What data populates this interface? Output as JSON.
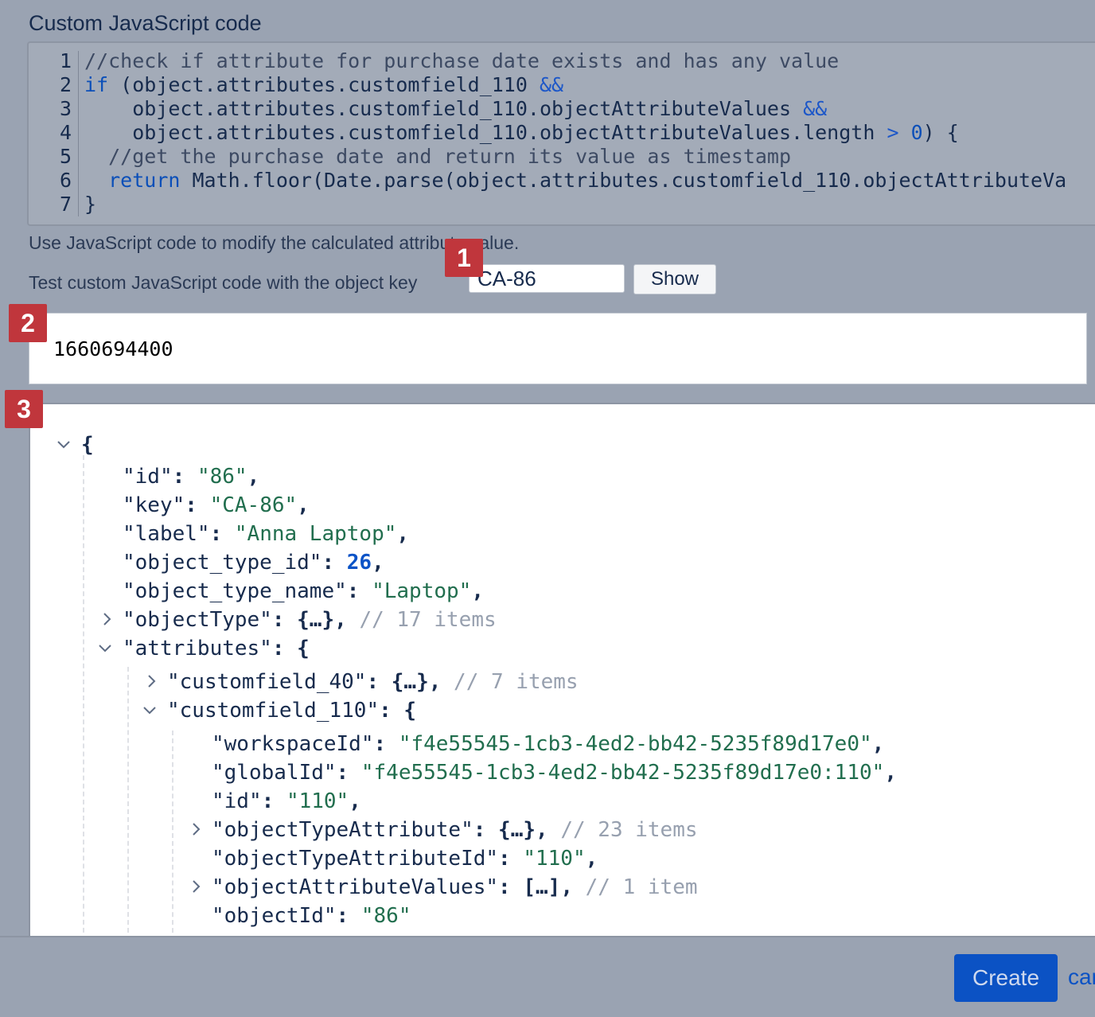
{
  "section_title": "Custom JavaScript code",
  "code_lines": [
    {
      "num": "1",
      "parts": [
        {
          "t": "//check if attribute for purchase date exists and has any value",
          "c": "comment"
        }
      ]
    },
    {
      "num": "2",
      "parts": [
        {
          "t": "if",
          "c": "kw"
        },
        {
          "t": " (object.attributes.customfield_110 ",
          "c": ""
        },
        {
          "t": "&&",
          "c": "op"
        }
      ]
    },
    {
      "num": "3",
      "parts": [
        {
          "t": "    object.attributes.customfield_110.objectAttributeValues ",
          "c": ""
        },
        {
          "t": "&&",
          "c": "op"
        }
      ]
    },
    {
      "num": "4",
      "parts": [
        {
          "t": "    object.attributes.customfield_110.objectAttributeValues.length ",
          "c": ""
        },
        {
          "t": ">",
          "c": "op"
        },
        {
          "t": " ",
          "c": ""
        },
        {
          "t": "0",
          "c": "num"
        },
        {
          "t": ") {",
          "c": ""
        }
      ]
    },
    {
      "num": "5",
      "parts": [
        {
          "t": "  //get the purchase date and return its value as timestamp",
          "c": "comment"
        }
      ]
    },
    {
      "num": "6",
      "parts": [
        {
          "t": "  ",
          "c": ""
        },
        {
          "t": "return",
          "c": "kw"
        },
        {
          "t": " Math.floor(Date.parse(object.attributes.customfield_110.objectAttributeVa",
          "c": ""
        }
      ]
    },
    {
      "num": "7",
      "parts": [
        {
          "t": "}",
          "c": ""
        }
      ]
    }
  ],
  "help_text": "Use JavaScript code to modify the calculated attribute value.",
  "test_label": "Test custom JavaScript code with the object key",
  "object_key_value": "CA-86",
  "show_label": "Show",
  "result_value": "1660694400",
  "badges": [
    "1",
    "2",
    "3"
  ],
  "json_lines": [
    {
      "toggle": "open",
      "parts": [
        {
          "t": "{",
          "c": "punc"
        }
      ]
    },
    {
      "parts": [
        {
          "t": "\"id\"",
          "c": ""
        },
        {
          "t": ": ",
          "c": "punc"
        },
        {
          "t": "\"86\"",
          "c": "str"
        },
        {
          "t": ",",
          "c": "punc"
        }
      ]
    },
    {
      "parts": [
        {
          "t": "\"key\"",
          "c": ""
        },
        {
          "t": ": ",
          "c": "punc"
        },
        {
          "t": "\"CA-86\"",
          "c": "str"
        },
        {
          "t": ",",
          "c": "punc"
        }
      ]
    },
    {
      "parts": [
        {
          "t": "\"label\"",
          "c": ""
        },
        {
          "t": ": ",
          "c": "punc"
        },
        {
          "t": "\"Anna Laptop\"",
          "c": "str"
        },
        {
          "t": ",",
          "c": "punc"
        }
      ]
    },
    {
      "parts": [
        {
          "t": "\"object_type_id\"",
          "c": ""
        },
        {
          "t": ": ",
          "c": "punc"
        },
        {
          "t": "26",
          "c": "num"
        },
        {
          "t": ",",
          "c": "punc"
        }
      ]
    },
    {
      "parts": [
        {
          "t": "\"object_type_name\"",
          "c": ""
        },
        {
          "t": ": ",
          "c": "punc"
        },
        {
          "t": "\"Laptop\"",
          "c": "str"
        },
        {
          "t": ",",
          "c": "punc"
        }
      ]
    },
    {
      "toggle": "closed",
      "parts": [
        {
          "t": "\"objectType\"",
          "c": ""
        },
        {
          "t": ": ",
          "c": "punc"
        },
        {
          "t": "{…}",
          "c": "ellipsis"
        },
        {
          "t": ", ",
          "c": "punc"
        },
        {
          "t": "// 17 items",
          "c": "comment"
        }
      ]
    },
    {
      "toggle": "open",
      "parts": [
        {
          "t": "\"attributes\"",
          "c": ""
        },
        {
          "t": ": {",
          "c": "punc"
        }
      ]
    },
    {
      "toggle": "closed",
      "parts": [
        {
          "t": "\"customfield_40\"",
          "c": ""
        },
        {
          "t": ": ",
          "c": "punc"
        },
        {
          "t": "{…}",
          "c": "ellipsis"
        },
        {
          "t": ", ",
          "c": "punc"
        },
        {
          "t": "// 7 items",
          "c": "comment"
        }
      ]
    },
    {
      "toggle": "open",
      "parts": [
        {
          "t": "\"customfield_110\"",
          "c": ""
        },
        {
          "t": ": {",
          "c": "punc"
        }
      ]
    },
    {
      "parts": [
        {
          "t": "\"workspaceId\"",
          "c": ""
        },
        {
          "t": ": ",
          "c": "punc"
        },
        {
          "t": "\"f4e55545-1cb3-4ed2-bb42-5235f89d17e0\"",
          "c": "str"
        },
        {
          "t": ",",
          "c": "punc"
        }
      ]
    },
    {
      "parts": [
        {
          "t": "\"globalId\"",
          "c": ""
        },
        {
          "t": ": ",
          "c": "punc"
        },
        {
          "t": "\"f4e55545-1cb3-4ed2-bb42-5235f89d17e0:110\"",
          "c": "str"
        },
        {
          "t": ",",
          "c": "punc"
        }
      ]
    },
    {
      "parts": [
        {
          "t": "\"id\"",
          "c": ""
        },
        {
          "t": ": ",
          "c": "punc"
        },
        {
          "t": "\"110\"",
          "c": "str"
        },
        {
          "t": ",",
          "c": "punc"
        }
      ]
    },
    {
      "toggle": "closed",
      "parts": [
        {
          "t": "\"objectTypeAttribute\"",
          "c": ""
        },
        {
          "t": ": ",
          "c": "punc"
        },
        {
          "t": "{…}",
          "c": "ellipsis"
        },
        {
          "t": ", ",
          "c": "punc"
        },
        {
          "t": "// 23 items",
          "c": "comment"
        }
      ]
    },
    {
      "parts": [
        {
          "t": "\"objectTypeAttributeId\"",
          "c": ""
        },
        {
          "t": ": ",
          "c": "punc"
        },
        {
          "t": "\"110\"",
          "c": "str"
        },
        {
          "t": ",",
          "c": "punc"
        }
      ]
    },
    {
      "toggle": "closed",
      "parts": [
        {
          "t": "\"objectAttributeValues\"",
          "c": ""
        },
        {
          "t": ": ",
          "c": "punc"
        },
        {
          "t": "[…]",
          "c": "ellipsis"
        },
        {
          "t": ", ",
          "c": "punc"
        },
        {
          "t": "// 1 item",
          "c": "comment"
        }
      ]
    },
    {
      "parts": [
        {
          "t": "\"objectId\"",
          "c": ""
        },
        {
          "t": ": ",
          "c": "punc"
        },
        {
          "t": "\"86\"",
          "c": "str"
        }
      ]
    }
  ],
  "footer": {
    "create_label": "Create",
    "cancel_label": "cancel"
  },
  "colors": {
    "overlay": "#9aa3b2",
    "primary": "#0b52c4",
    "badge": "#c0363c",
    "json_string": "#216e4e",
    "json_number": "#0b53c7"
  }
}
